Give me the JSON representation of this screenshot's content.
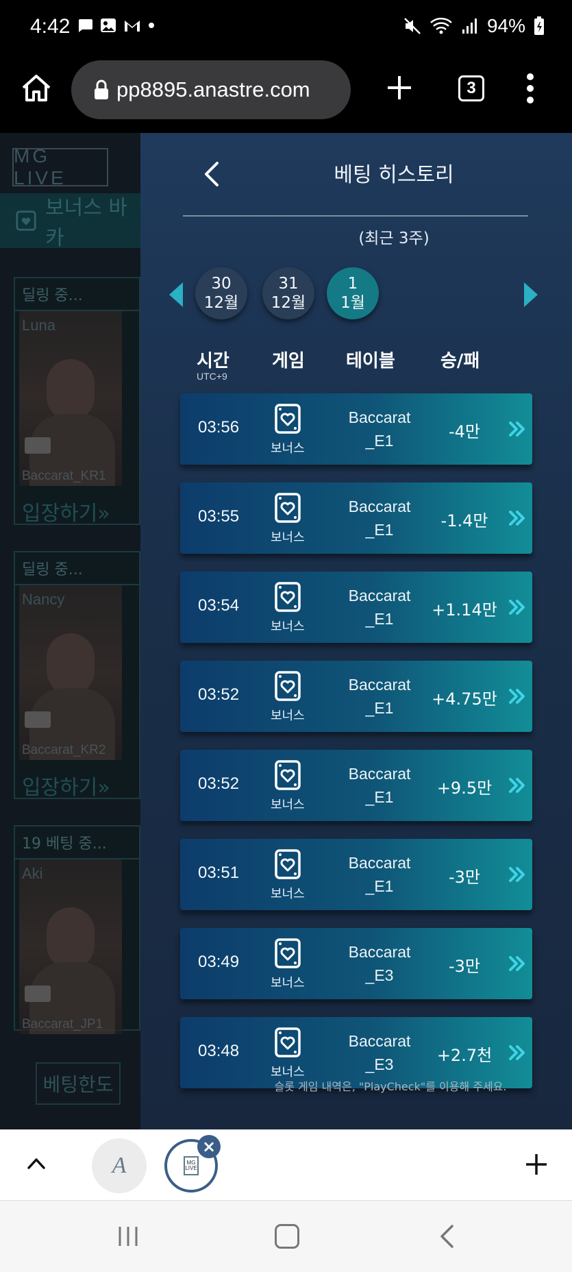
{
  "status_bar": {
    "time": "4:42",
    "battery": "94%"
  },
  "browser": {
    "url": "pp8895.anastre.com",
    "tab_count": "3"
  },
  "lobby": {
    "logo": "MG LIVE",
    "category": "보너스 바카",
    "cards": [
      {
        "status": "딜링 중...",
        "dealer": "Luna",
        "table": "Baccarat_KR1",
        "enter": "입장하기»"
      },
      {
        "status": "딜링 중...",
        "dealer": "Nancy",
        "table": "Baccarat_KR2",
        "enter": "입장하기»"
      },
      {
        "status": "19  베팅 중...",
        "dealer": "Aki",
        "table": "Baccarat_JP1",
        "enter": ""
      }
    ],
    "limit_button": "베팅한도"
  },
  "panel": {
    "title": "베팅 히스토리",
    "subtitle": "(최근 3주)",
    "dates": [
      {
        "day": "30",
        "month": "12월",
        "active": false
      },
      {
        "day": "31",
        "month": "12월",
        "active": false
      },
      {
        "day": "1",
        "month": "1월",
        "active": true
      }
    ],
    "columns": {
      "time": "시간",
      "timezone": "UTC+9",
      "game": "게임",
      "table": "테이블",
      "result": "승/패"
    },
    "rows": [
      {
        "time": "03:56",
        "game": "보너스",
        "table_line1": "Baccarat",
        "table_line2": "_E1",
        "result": "-4만"
      },
      {
        "time": "03:55",
        "game": "보너스",
        "table_line1": "Baccarat",
        "table_line2": "_E1",
        "result": "-1.4만"
      },
      {
        "time": "03:54",
        "game": "보너스",
        "table_line1": "Baccarat",
        "table_line2": "_E1",
        "result": "+1.14만"
      },
      {
        "time": "03:52",
        "game": "보너스",
        "table_line1": "Baccarat",
        "table_line2": "_E1",
        "result": "+4.75만"
      },
      {
        "time": "03:52",
        "game": "보너스",
        "table_line1": "Baccarat",
        "table_line2": "_E1",
        "result": "+9.5만"
      },
      {
        "time": "03:51",
        "game": "보너스",
        "table_line1": "Baccarat",
        "table_line2": "_E1",
        "result": "-3만"
      },
      {
        "time": "03:49",
        "game": "보너스",
        "table_line1": "Baccarat",
        "table_line2": "_E3",
        "result": "-3만"
      },
      {
        "time": "03:48",
        "game": "보너스",
        "table_line1": "Baccarat",
        "table_line2": "_E3",
        "result": "+2.7천"
      }
    ],
    "note": "슬롯 게임 내역은, \"PlayCheck\"를 이용해 주세요."
  },
  "bottom_bar": {
    "tab1_letter": "A",
    "tab2_logo": "MG LIVE"
  },
  "icons": {
    "accent": "#2bb0c4",
    "row_icon": "card-heart-icon",
    "chevron": "double-chevron-right-icon"
  }
}
